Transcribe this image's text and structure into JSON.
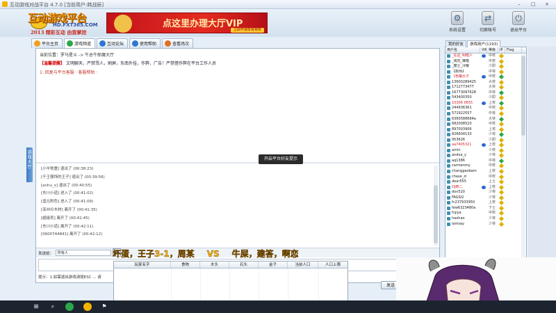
{
  "window": {
    "title": "互动游戏对战平台 4.7.0 [当前用户:韩战辰]",
    "controls": [
      "–",
      "□",
      "×"
    ]
  },
  "header": {
    "logo_main": "互动游戏平台",
    "logo_url": "HD.FXT365.COM",
    "logo_slogan": "2013 精彩互动 由我掌控",
    "banner_text": "点这里办理大厅VIP",
    "banner_button": "立即开通享有特权"
  },
  "toolbar": {
    "tools": [
      {
        "label": "系统设置",
        "icon": "gear-icon"
      },
      {
        "label": "切换帐号",
        "icon": "switch-user-icon"
      },
      {
        "label": "退出平台",
        "icon": "exit-icon"
      }
    ]
  },
  "tabs": [
    {
      "label": "平台主页",
      "color": "#f0a020"
    },
    {
      "label": "游戏频道",
      "color": "#2aa84a"
    },
    {
      "label": "互动论坛",
      "color": "#2f77d0"
    },
    {
      "label": "使用帮助",
      "color": "#2f77d0"
    },
    {
      "label": "查看场次",
      "color": "#e07020"
    }
  ],
  "side_tab": "游戏大厅",
  "main": {
    "location": "当前位置：罗马星斗 -> 牛总牛郎魔大厅",
    "notice_tag": "【温馨提醒】",
    "notice": "文明聊天，严禁骂人，刷屏，东南外挂，作弊，广告！严禁借作弊在平台工作人员",
    "notice_link": "1: 回复与平台客服 · 客服帮助 ·",
    "toast": "开启平台好友提示",
    "log": [
      "[小牛牧童] 退出了 (00:38:23)",
      "[千王服饰的王子] 退出了 (00:39:56)",
      "[anhu_x] 退出了 (00:40:55)",
      "[东川小道] 进入了 (00:41:02)",
      "[逗元附色] 进入了 (00:41:09)",
      "[亚州の木材] 离开了 (00:41:35)",
      "[超级死] 离开了 (00:41:45)",
      "[东川小道] 离开了 (00:42:11)",
      "[0600744841] 离开了 (00:42:12)"
    ],
    "send_label": "发送给：",
    "send_target": "所有人",
    "bottom_text": "提示：1.如需退出游戏请按ESC ... 请",
    "send_button": "发送"
  },
  "stream_overlay": {
    "left": "坏蛋，王子3-1，周某",
    "vs": "VS",
    "right": "牛屎，建答，啊恋"
  },
  "game_table": {
    "headers": [
      "玩家名字",
      "食物",
      "木头",
      "石头",
      "金子",
      "当前人口",
      "人口上限"
    ]
  },
  "right_panel": {
    "tabs": [
      "我的好友",
      "游戏用户(1193)"
    ],
    "headers": [
      "用户名",
      "VIP",
      "等级",
      "IP",
      "Flag"
    ],
    "users": [
      {
        "name": "_在这_明暗人",
        "vip": true,
        "level": "中校",
        "gem": "#e0b000"
      },
      {
        "name": "_残花_琳暗",
        "vip": false,
        "level": "中校",
        "gem": "#e0b000"
      },
      {
        "name": "_嫂士_冷暖",
        "vip": false,
        "level": "少尉",
        "gem": "#e0b000"
      },
      {
        "name": "【颓师】",
        "vip": false,
        "level": "中将",
        "gem": "#e0b000"
      },
      {
        "name": "【色魔大才",
        "vip": true,
        "level": "中校",
        "gem": "#2aa84a"
      },
      {
        "name": "13600289425",
        "vip": false,
        "level": "大校",
        "gem": "#e0b000"
      },
      {
        "name": "1712773477",
        "vip": false,
        "level": "大将",
        "gem": "#e0b000"
      },
      {
        "name": "16773097628",
        "vip": false,
        "level": "中将",
        "gem": "#2aa84a"
      },
      {
        "name": "543400350",
        "vip": false,
        "level": "少尉",
        "gem": "#e0b000"
      },
      {
        "name": "10306 0655",
        "vip": true,
        "level": "上校",
        "gem": "#2aa84a"
      },
      {
        "name": "244936361",
        "vip": false,
        "level": "中校",
        "gem": "#e0b000"
      },
      {
        "name": "571922557",
        "vip": false,
        "level": "中将",
        "gem": "#e0b000"
      },
      {
        "name": "6360588684a",
        "vip": false,
        "level": "大将",
        "gem": "#2aa84a"
      },
      {
        "name": "682008520",
        "vip": false,
        "level": "中校",
        "gem": "#e0b000"
      },
      {
        "name": "897003906",
        "vip": false,
        "level": "上将",
        "gem": "#e0b000"
      },
      {
        "name": "826604133",
        "vip": false,
        "level": "少将",
        "gem": "#2aa84a"
      },
      {
        "name": "953626",
        "vip": false,
        "level": "少尉",
        "gem": "#e0b000"
      },
      {
        "name": "aa7405321",
        "vip": true,
        "level": "上校",
        "gem": "#e0b000"
      },
      {
        "name": "amin",
        "vip": false,
        "level": "少校",
        "gem": "#e0b000"
      },
      {
        "name": "andoa_y",
        "vip": false,
        "level": "少将",
        "gem": "#e0b000"
      },
      {
        "name": "aq1386",
        "vip": false,
        "level": "中将",
        "gem": "#2aa84a"
      },
      {
        "name": "carmenmy",
        "vip": false,
        "level": "中校",
        "gem": "#e0b000"
      },
      {
        "name": "changgaobam",
        "vip": false,
        "level": "上校",
        "gem": "#e0b000"
      },
      {
        "name": "chase_zi",
        "vip": false,
        "level": "中校",
        "gem": "#e0b000"
      },
      {
        "name": "dear555",
        "vip": false,
        "level": "上士",
        "gem": "#e0b000"
      },
      {
        "name": "DJ疯二",
        "vip": true,
        "level": "上校",
        "gem": "#e0b000"
      },
      {
        "name": "don520",
        "vip": false,
        "level": "少将",
        "gem": "#e0b000"
      },
      {
        "name": "FAGSI2",
        "vip": false,
        "level": "少将",
        "gem": "#e0b000"
      },
      {
        "name": "fc237933950",
        "vip": false,
        "level": "上校",
        "gem": "#e0b000"
      },
      {
        "name": "few6323480a",
        "vip": false,
        "level": "下士",
        "gem": "#e0b000"
      },
      {
        "name": "fujiya",
        "vip": false,
        "level": "中校",
        "gem": "#e0b000"
      },
      {
        "name": "haohao",
        "vip": false,
        "level": "少将",
        "gem": "#e0b000"
      },
      {
        "name": "iamsay",
        "vip": false,
        "level": "少将",
        "gem": "#e0b000"
      }
    ]
  }
}
